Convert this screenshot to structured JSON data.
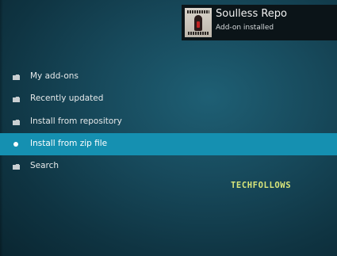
{
  "notification": {
    "title": "Soulless Repo",
    "subtitle": "Add-on installed",
    "thumbnail_icon": "repo-album-art"
  },
  "menu": {
    "items": [
      {
        "label": "My add-ons",
        "icon": "folder-icon",
        "selected": false
      },
      {
        "label": "Recently updated",
        "icon": "folder-icon",
        "selected": false
      },
      {
        "label": "Install from repository",
        "icon": "folder-icon",
        "selected": false
      },
      {
        "label": "Install from zip file",
        "icon": "bullet-icon",
        "selected": true
      },
      {
        "label": "Search",
        "icon": "folder-icon",
        "selected": false
      }
    ]
  },
  "watermark": {
    "text": "TECHFOLLOWS"
  },
  "colors": {
    "selected_row": "#1590b1",
    "background": "#17495b",
    "watermark": "#d9e67a"
  }
}
